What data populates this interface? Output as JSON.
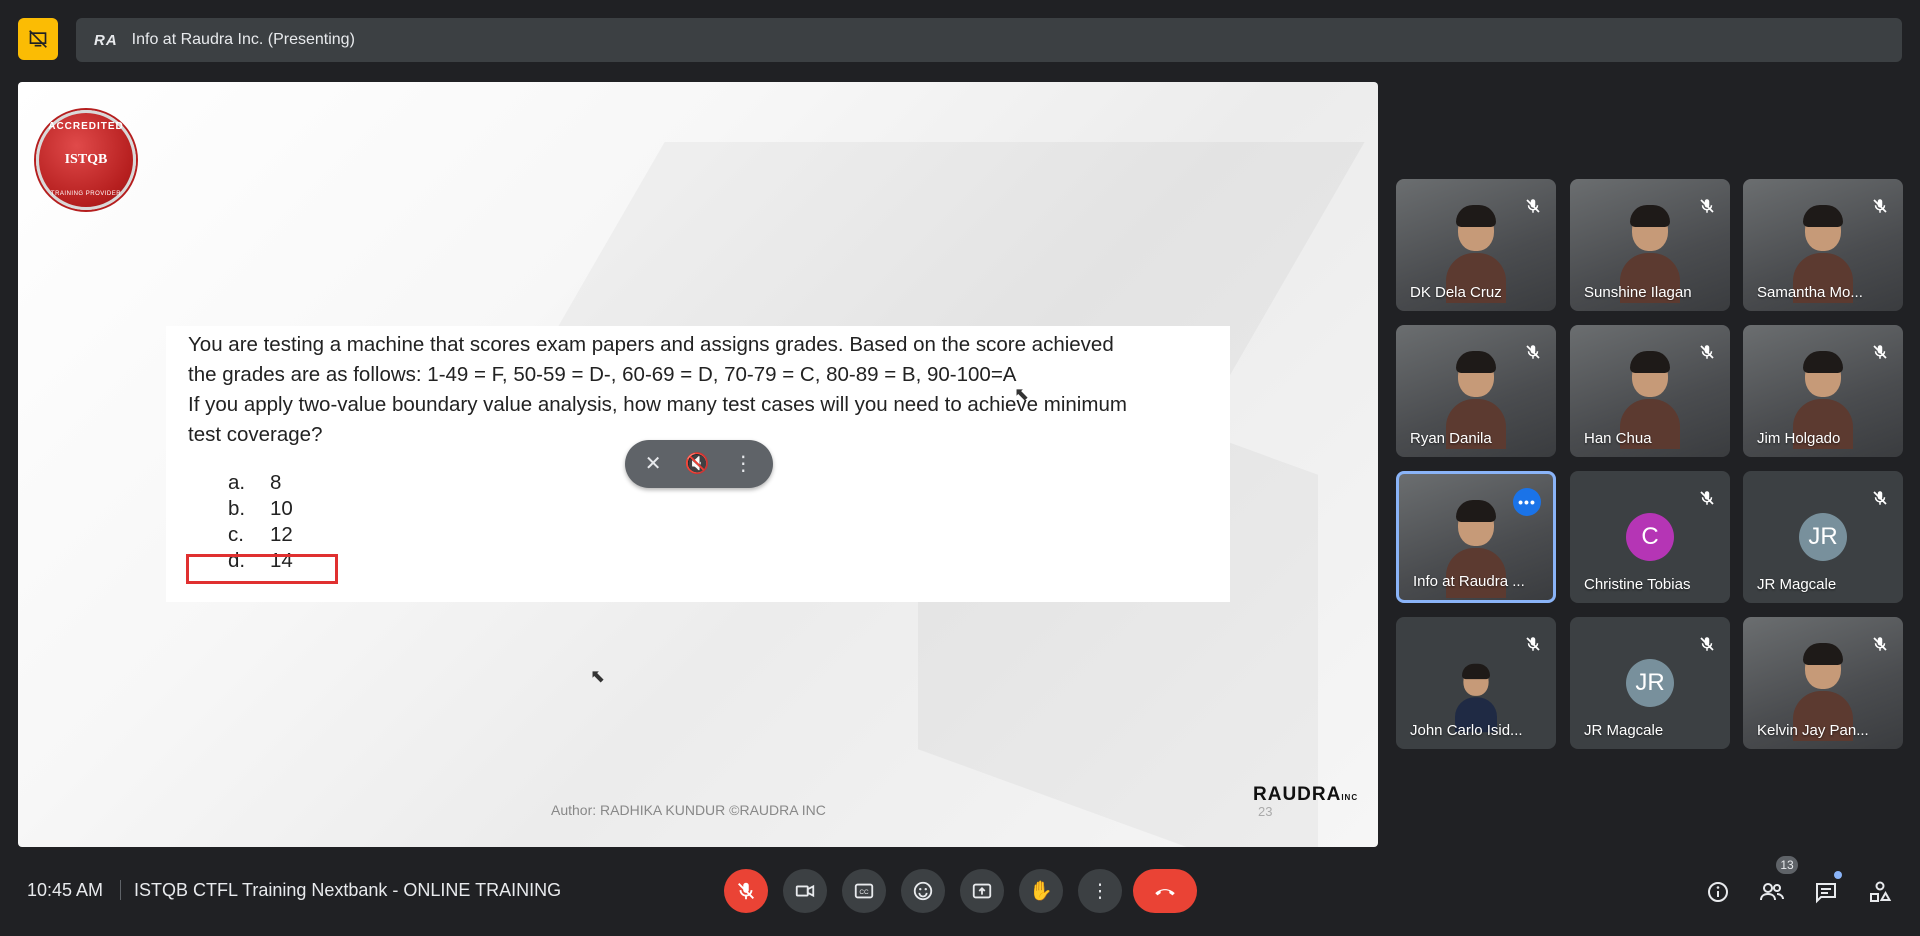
{
  "presenting_bar": {
    "logo": "RA",
    "title": "Info at Raudra Inc. (Presenting)"
  },
  "slide": {
    "badge": {
      "top": "ACCREDITED",
      "middle": "ISTQB",
      "bottom": "TRAINING PROVIDER"
    },
    "question_lines": [
      "You are testing a machine that scores exam papers and assigns grades. Based on the score achieved",
      "the grades are as follows: 1-49 = F, 50-59 = D-, 60-69 = D, 70-79 = C, 80-89 = B, 90-100=A",
      "If you apply two-value boundary value analysis, how many test cases will you need to achieve minimum",
      "test coverage?"
    ],
    "options": [
      {
        "letter": "a.",
        "value": "8"
      },
      {
        "letter": "b.",
        "value": "10"
      },
      {
        "letter": "c.",
        "value": "12"
      },
      {
        "letter": "d.",
        "value": "14"
      }
    ],
    "author": "Author: RADHIKA KUNDUR ©RAUDRA INC",
    "page_number": "23",
    "brand": "RAUDRA",
    "brand_suffix": "INC"
  },
  "participants": [
    {
      "name": "DK Dela Cruz",
      "type": "video",
      "muted": true
    },
    {
      "name": "Sunshine Ilagan",
      "type": "video",
      "muted": true
    },
    {
      "name": "Samantha Mo...",
      "type": "video",
      "muted": true
    },
    {
      "name": "Ryan Danila",
      "type": "video",
      "muted": true
    },
    {
      "name": "Han Chua",
      "type": "video",
      "muted": true
    },
    {
      "name": "Jim Holgado",
      "type": "video",
      "muted": true
    },
    {
      "name": "Info at Raudra ...",
      "type": "video",
      "muted": false,
      "active": true
    },
    {
      "name": "Christine Tobias",
      "type": "avatar",
      "initial": "C",
      "color": "#b535b5",
      "muted": true
    },
    {
      "name": "JR Magcale",
      "type": "avatar",
      "initial": "JR",
      "color": "#78909c",
      "muted": true
    },
    {
      "name": "John Carlo Isid...",
      "type": "photo",
      "muted": true
    },
    {
      "name": "JR Magcale",
      "type": "avatar",
      "initial": "JR",
      "color": "#78909c",
      "muted": true
    },
    {
      "name": "Kelvin Jay Pan...",
      "type": "video",
      "muted": true
    }
  ],
  "bottom_bar": {
    "time": "10:45 AM",
    "meeting_title": "ISTQB CTFL Training Nextbank - ONLINE TRAINING",
    "participant_count": "13"
  },
  "colors": {
    "accent_yellow": "#fbbc04",
    "end_call_red": "#ea4335",
    "active_border": "#8ab4f8",
    "answer_box": "#e03030"
  },
  "icons": [
    "hide-presentation-icon",
    "mic-off-icon",
    "camera-icon",
    "captions-icon",
    "emoji-icon",
    "present-icon",
    "raise-hand-icon",
    "more-options-icon",
    "end-call-icon",
    "info-icon",
    "people-icon",
    "chat-icon",
    "activities-icon"
  ]
}
